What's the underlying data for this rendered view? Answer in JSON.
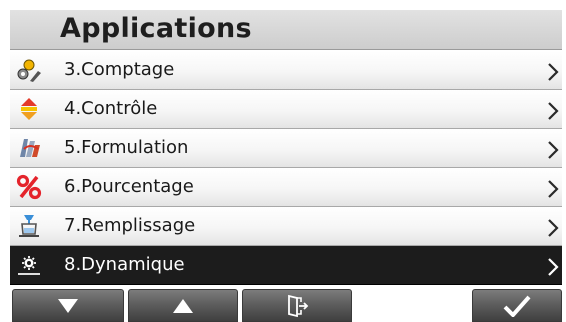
{
  "header": {
    "title": "Applications"
  },
  "menu": {
    "items": [
      {
        "label": "3.Comptage",
        "icon": "counting-icon",
        "selected": false
      },
      {
        "label": "4.Contrôle",
        "icon": "checkweigh-icon",
        "selected": false
      },
      {
        "label": "5.Formulation",
        "icon": "formulation-icon",
        "selected": false
      },
      {
        "label": "6.Pourcentage",
        "icon": "percent-icon",
        "selected": false
      },
      {
        "label": "7.Remplissage",
        "icon": "filling-icon",
        "selected": true
      },
      {
        "label": "8.Dynamique",
        "icon": "dynamic-icon",
        "selected": false
      }
    ]
  },
  "buttons": {
    "down": "arrow-down-icon",
    "up": "arrow-up-icon",
    "exit": "exit-icon",
    "confirm": "checkmark-icon"
  },
  "colors": {
    "selected_row": "#1c1c1c",
    "button": "#5e5e5e",
    "percent": "#e4232b"
  }
}
